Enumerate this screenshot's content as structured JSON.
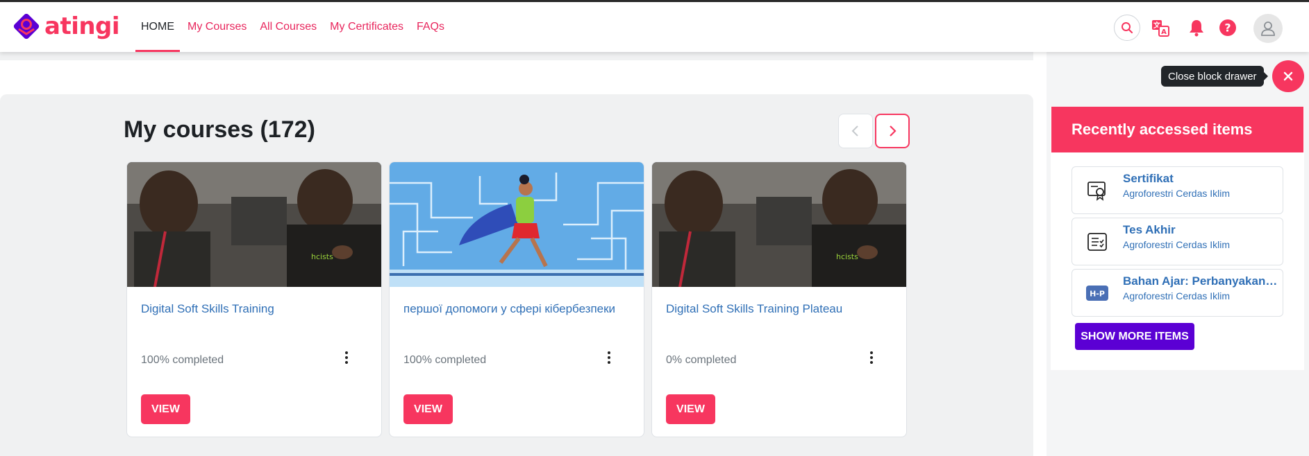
{
  "brand": {
    "name": "atingi",
    "accent": "#f7365f",
    "purple": "#5b00d4"
  },
  "nav": {
    "items": [
      {
        "label": "HOME",
        "active": true
      },
      {
        "label": "My Courses",
        "active": false
      },
      {
        "label": "All Courses",
        "active": false
      },
      {
        "label": "My Certificates",
        "active": false
      },
      {
        "label": "FAQs",
        "active": false
      }
    ]
  },
  "header_icons": [
    "search-icon",
    "language-icon",
    "bell-icon",
    "help-icon",
    "user-avatar-icon"
  ],
  "my_courses": {
    "title": "My courses (172)",
    "courses": [
      {
        "title": "Digital Soft Skills Training",
        "progress": "100% completed",
        "progress_value": 100,
        "action": "VIEW",
        "image": "workshop-photo"
      },
      {
        "title": "першої допомоги у сфері кібербезпеки",
        "progress": "100% completed",
        "progress_value": 100,
        "action": "VIEW",
        "image": "superhero-illustration"
      },
      {
        "title": "Digital Soft Skills Training Plateau",
        "progress": "0% completed",
        "progress_value": 0,
        "action": "VIEW",
        "image": "workshop-photo"
      }
    ]
  },
  "drawer": {
    "tooltip": "Close block drawer",
    "block_title": "Recently accessed items",
    "items": [
      {
        "name": "Sertifikat",
        "course": "Agroforestri Cerdas Iklim",
        "icon": "certificate-icon"
      },
      {
        "name": "Tes Akhir",
        "course": "Agroforestri Cerdas Iklim",
        "icon": "quiz-icon"
      },
      {
        "name": "Bahan Ajar: Perbanyakan Vegetatif",
        "course": "Agroforestri Cerdas Iklim",
        "icon": "h5p-icon"
      }
    ],
    "show_more": "SHOW MORE ITEMS"
  }
}
